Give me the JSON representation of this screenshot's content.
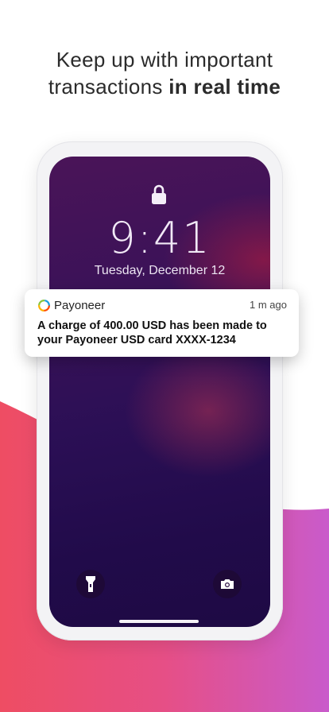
{
  "headline": {
    "line1": "Keep up with important",
    "line2_regular": "transactions ",
    "line2_bold": "in real time"
  },
  "lockscreen": {
    "time": "9:41",
    "date": "Tuesday, December 12"
  },
  "notification": {
    "app_name": "Payoneer",
    "time_ago": "1 m ago",
    "message": "A charge of 400.00 USD has been made to your Payoneer USD card XXXX-1234"
  },
  "icons": {
    "lock": "lock-icon",
    "flashlight": "flashlight-icon",
    "camera": "camera-icon",
    "app_logo": "payoneer-logo-icon"
  },
  "colors": {
    "wave_start": "#ec4f68",
    "wave_end": "#c95bc9",
    "screen_top": "#4a1458",
    "screen_bottom": "#1e0a44"
  }
}
